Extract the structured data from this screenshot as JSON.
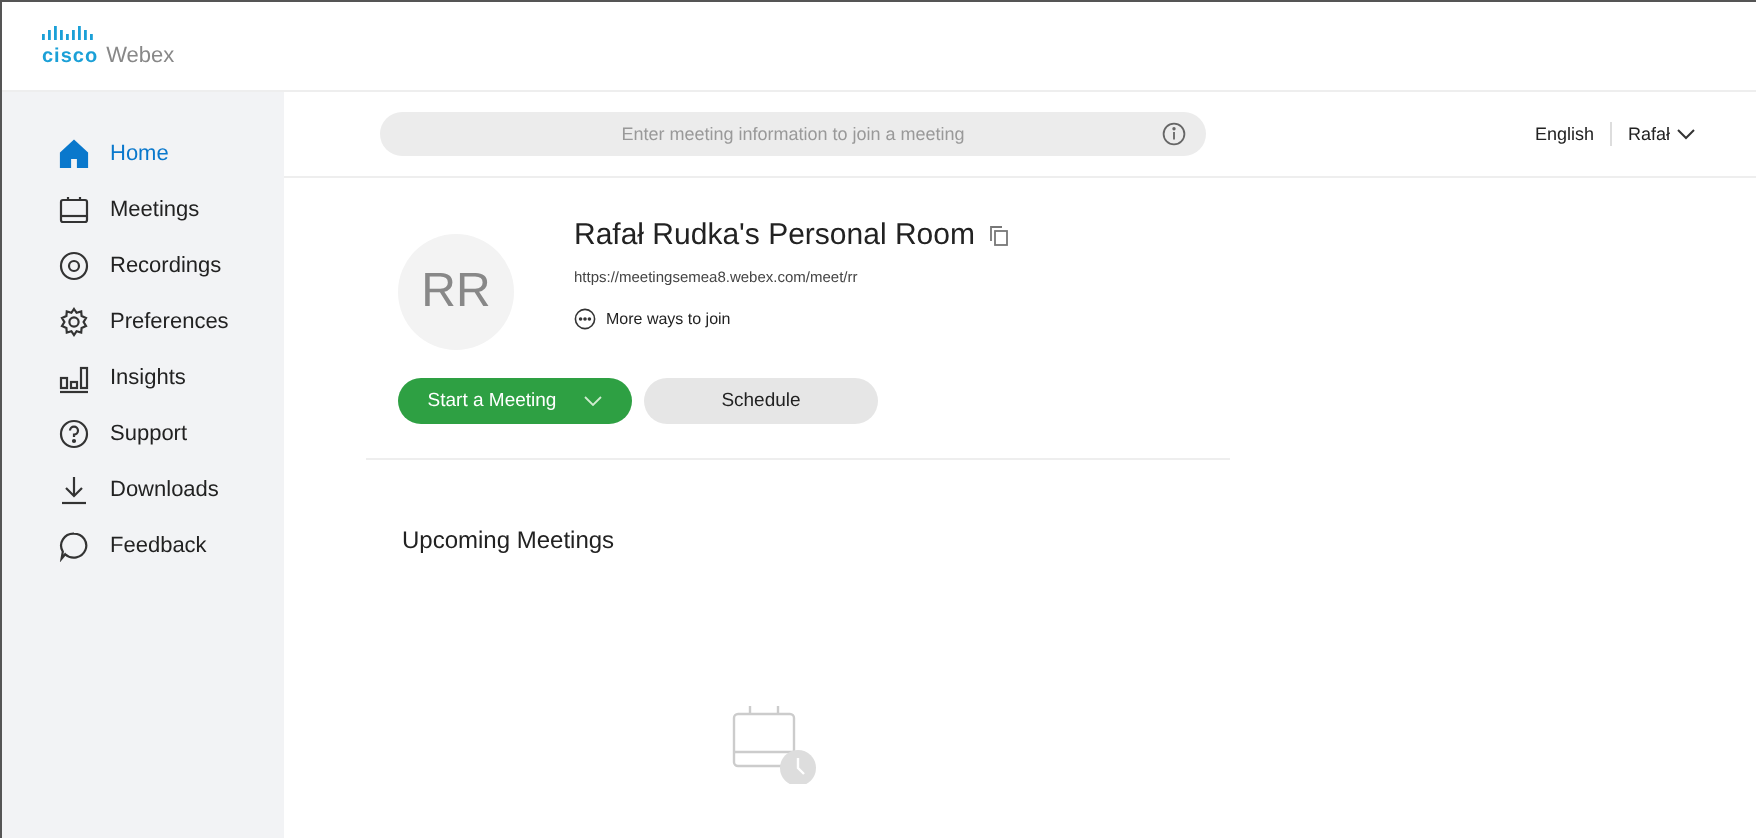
{
  "logo": {
    "brand": "cisco",
    "product": "Webex"
  },
  "sidebar": {
    "items": [
      {
        "label": "Home",
        "selected": true
      },
      {
        "label": "Meetings",
        "selected": false
      },
      {
        "label": "Recordings",
        "selected": false
      },
      {
        "label": "Preferences",
        "selected": false
      },
      {
        "label": "Insights",
        "selected": false
      },
      {
        "label": "Support",
        "selected": false
      },
      {
        "label": "Downloads",
        "selected": false
      },
      {
        "label": "Feedback",
        "selected": false
      }
    ]
  },
  "search": {
    "placeholder": "Enter meeting information to join a meeting"
  },
  "top_right": {
    "language": "English",
    "user": "Rafał"
  },
  "room": {
    "initials": "RR",
    "title": "Rafał Rudka's Personal Room",
    "url": "https://meetingsemea8.webex.com/meet/rr",
    "more_ways": "More ways to join"
  },
  "buttons": {
    "start": "Start a Meeting",
    "schedule": "Schedule"
  },
  "upcoming": {
    "title": "Upcoming Meetings"
  }
}
